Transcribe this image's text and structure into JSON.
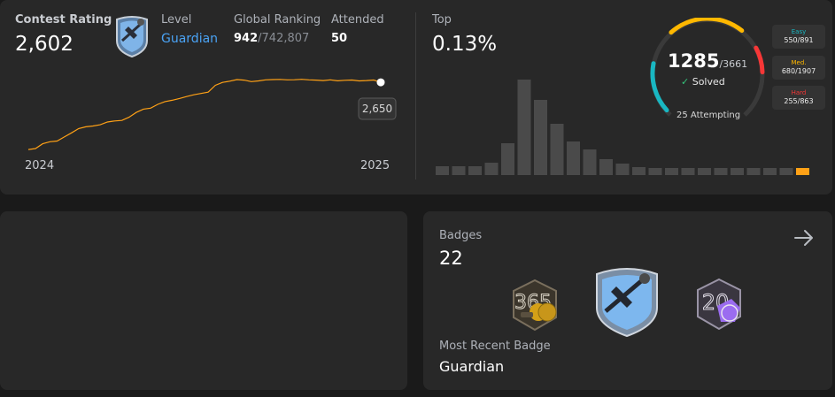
{
  "contest": {
    "title": "Contest Rating",
    "rating": "2,602",
    "level_label": "Level",
    "level_value": "Guardian",
    "global_ranking_label": "Global Ranking",
    "global_rank": "942",
    "global_total": "742,807",
    "attended_label": "Attended",
    "attended_value": "50",
    "tooltip_value": "2,650",
    "year_start": "2024",
    "year_end": "2025",
    "accent": "#ffa116"
  },
  "chart_data": [
    {
      "type": "line",
      "title": "",
      "x": [
        0,
        1,
        2,
        3,
        4,
        5,
        6,
        7,
        8,
        9,
        10,
        11,
        12,
        13,
        14,
        15,
        16,
        17,
        18,
        19,
        20,
        21,
        22,
        23,
        24,
        25,
        26,
        27,
        28,
        29,
        30,
        31,
        32,
        33,
        34,
        35,
        36,
        37,
        38,
        39,
        40,
        41,
        42,
        43,
        44,
        45,
        46,
        47,
        48,
        49
      ],
      "values": [
        2108,
        2115,
        2150,
        2165,
        2170,
        2200,
        2230,
        2262,
        2275,
        2281,
        2290,
        2310,
        2318,
        2322,
        2345,
        2380,
        2405,
        2412,
        2440,
        2460,
        2470,
        2483,
        2497,
        2510,
        2520,
        2530,
        2580,
        2601,
        2610,
        2622,
        2618,
        2607,
        2612,
        2620,
        2622,
        2623,
        2620,
        2621,
        2624,
        2620,
        2618,
        2615,
        2620,
        2613,
        2617,
        2619,
        2612,
        2615,
        2619,
        2602
      ],
      "xlabel": "",
      "ylabel": "",
      "xlim": [
        "2024",
        "2025"
      ],
      "highlight_label": "2,650"
    },
    {
      "type": "bar",
      "title": "",
      "values": [
        1,
        1,
        1,
        1.4,
        3.6,
        10.8,
        8.5,
        5.8,
        3.8,
        2.9,
        1.8,
        1.3,
        0.9,
        0.8,
        0.8,
        0.8,
        0.8,
        0.8,
        0.8,
        0.8,
        0.8,
        0.8,
        0.8
      ],
      "highlight_index": 22
    }
  ],
  "top": {
    "label": "Top",
    "value": "0.13%"
  },
  "solved": {
    "count": "1285",
    "total": "/3661",
    "label": "Solved",
    "attempting": "25 Attempting",
    "easy_label": "Easy",
    "easy_count": "550/891",
    "medium_label": "Med.",
    "medium_count": "680/1907",
    "hard_label": "Hard",
    "hard_count": "255/863",
    "easy_fraction": 0.617,
    "medium_fraction": 0.357,
    "hard_fraction": 0.295,
    "easy_color": "#19b7c2",
    "medium_color": "#ffb800",
    "hard_color": "#f63737"
  },
  "badges": {
    "label": "Badges",
    "count": "22",
    "recent_label": "Most Recent Badge",
    "recent_name": "Guardian",
    "badge_icons": [
      "365-days-badge-icon",
      "guardian-badge-icon",
      "200-days-badge-icon"
    ]
  }
}
